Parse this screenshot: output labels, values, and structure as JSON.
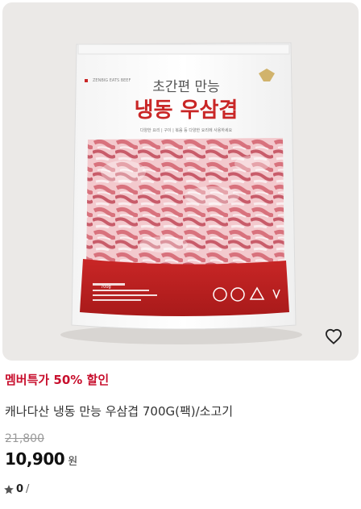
{
  "product_image": {
    "package_small_text": "ZENBIG EATS BEEF",
    "package_title_line1": "초간편 만능",
    "package_title_line2": "냉동 우삼겹",
    "package_subtitle": "다양한 요리 | 구이 | 볶음 등 다양한 요리에 사용하세요",
    "package_weight": "700g",
    "bag_accent_color": "#cc2a2a",
    "background_color": "#ebe9e7"
  },
  "promo_label": "멤버특가 50% 할인",
  "product_name": "캐나다산 냉동 만능 우삼겹 700G(팩)/소고기",
  "original_price": "21,800",
  "price": "10,900",
  "currency": "원",
  "rating": {
    "icon": "star-icon",
    "count": "0",
    "separator": "/"
  },
  "wishlist_icon": "heart-icon",
  "colors": {
    "promo": "#c8102e",
    "price": "#111111",
    "strikethrough": "#9a9a9a"
  }
}
